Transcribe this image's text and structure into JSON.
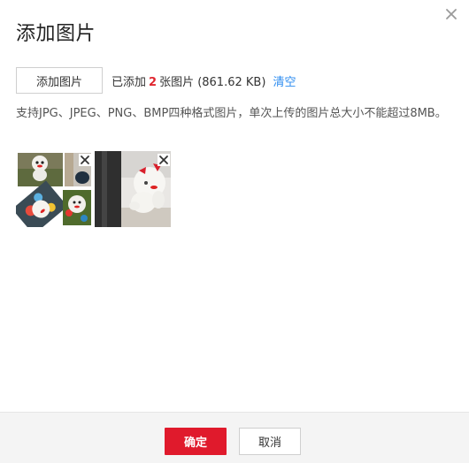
{
  "dialog": {
    "title": "添加图片",
    "close_icon": "close-icon"
  },
  "upload": {
    "add_button_label": "添加图片",
    "status_prefix": "已添加",
    "count": "2",
    "status_suffix": "张图片 (861.62 KB)",
    "clear_label": "清空"
  },
  "hint": "支持JPG、JPEG、PNG、BMP四种格式图片，单次上传的图片总大小不能超过8MB。",
  "thumbnails": [
    {
      "remove_icon": "remove-icon"
    },
    {
      "remove_icon": "remove-icon"
    }
  ],
  "footer": {
    "ok_label": "确定",
    "cancel_label": "取消"
  },
  "colors": {
    "accent": "#e01a2c",
    "link": "#2d8cf0",
    "count": "#e0262f"
  }
}
